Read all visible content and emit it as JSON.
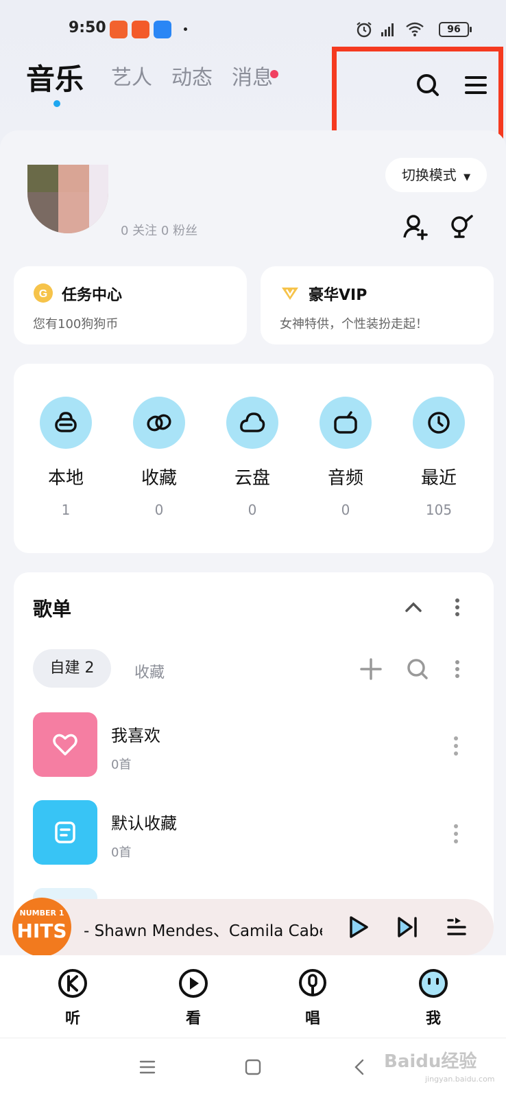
{
  "status_bar": {
    "time": "9:50",
    "battery": "96"
  },
  "header": {
    "tabs": [
      {
        "label": "音乐",
        "active": true
      },
      {
        "label": "艺人",
        "active": false
      },
      {
        "label": "动态",
        "active": false
      },
      {
        "label": "消息",
        "active": false,
        "has_dot": true
      }
    ],
    "icons": [
      "search-icon",
      "menu-icon"
    ]
  },
  "profile": {
    "mode_button": "切换模式",
    "follow_stats": "0 关注 0 粉丝"
  },
  "promo_cards": [
    {
      "title": "任务中心",
      "subtitle": "您有100狗狗币",
      "icon": "coin-icon"
    },
    {
      "title": "豪华VIP",
      "subtitle": "女神特供，个性装扮走起！",
      "icon": "vip-diamond-icon"
    }
  ],
  "quick_access": [
    {
      "label": "本地",
      "count": "1",
      "icon": "local-icon"
    },
    {
      "label": "收藏",
      "count": "0",
      "icon": "favorite-icon"
    },
    {
      "label": "云盘",
      "count": "0",
      "icon": "cloud-icon"
    },
    {
      "label": "音频",
      "count": "0",
      "icon": "radio-icon"
    },
    {
      "label": "最近",
      "count": "105",
      "icon": "clock-icon"
    }
  ],
  "playlists": {
    "title": "歌单",
    "tabs": {
      "created": "自建 2",
      "collected": "收藏"
    },
    "items": [
      {
        "name": "我喜欢",
        "count": "0首",
        "color": "#f57ea2",
        "icon": "heart-icon"
      },
      {
        "name": "默认收藏",
        "count": "0首",
        "color": "#38c4f5",
        "icon": "note-icon"
      }
    ]
  },
  "player": {
    "cover_line1": "NUMBER 1",
    "cover_line2": "HITS",
    "track": "- Shawn Mendes、Camila Cabello",
    "accent": "#1ea7f0"
  },
  "bottom_nav": [
    {
      "label": "听",
      "icon": "listen-icon"
    },
    {
      "label": "看",
      "icon": "watch-icon"
    },
    {
      "label": "唱",
      "icon": "sing-icon"
    },
    {
      "label": "我",
      "icon": "me-icon"
    }
  ],
  "watermark": {
    "main": "Baidu经验",
    "sub": "jingyan.baidu.com"
  }
}
